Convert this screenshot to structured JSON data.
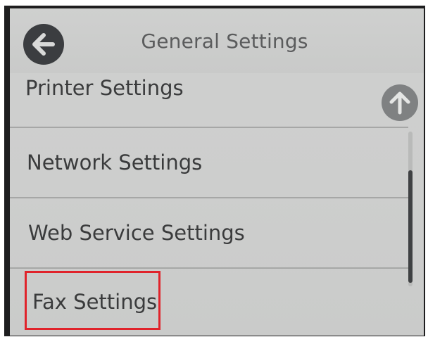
{
  "header": {
    "title": "General Settings",
    "back_icon": "arrow-left-icon"
  },
  "menu": {
    "items": [
      {
        "label": "Printer Settings"
      },
      {
        "label": "Network Settings"
      },
      {
        "label": "Web Service Settings"
      },
      {
        "label": "Fax Settings"
      }
    ],
    "selected_item": "Fax Settings"
  },
  "scroll": {
    "up_icon": "arrow-up-icon",
    "position_fraction": 0.75
  },
  "colors": {
    "screen_background": "#cdcecd",
    "text": "#3a3b3c",
    "title_text": "#5b5c5d",
    "button_dark": "#3b3d40",
    "button_grey": "#7f8182",
    "highlight_border": "#e0232b"
  }
}
